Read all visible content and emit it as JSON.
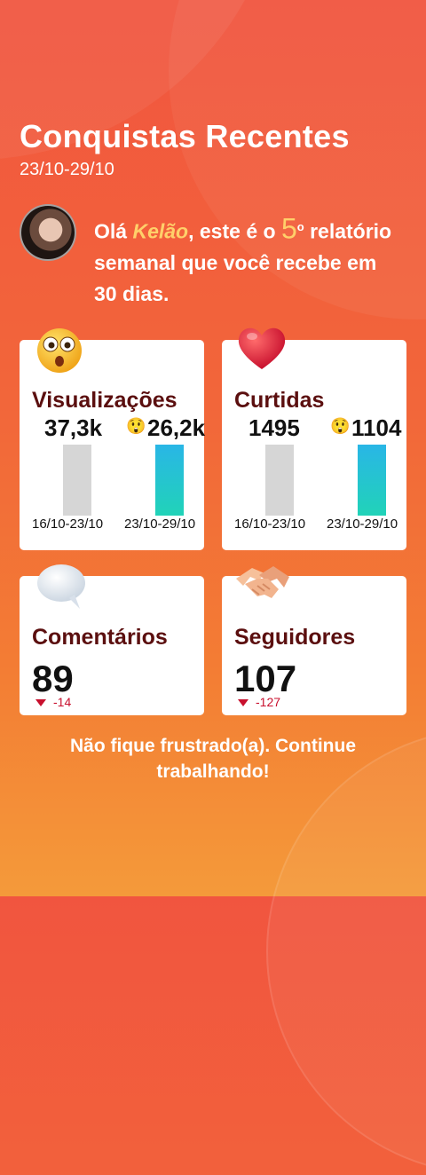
{
  "header": {
    "title": "Conquistas Recentes",
    "date_range": "23/10-29/10"
  },
  "greeting": {
    "prefix": "Olá ",
    "name": "Kelão",
    "middle": ", este é o ",
    "number": "5",
    "ordinal": "o",
    "suffix": "relatório semanal que você recebe em 30 dias."
  },
  "cards": {
    "views": {
      "label": "Visualizações",
      "previous_value": "37,3k",
      "current_value": "26,2k",
      "previous_range": "16/10-23/10",
      "current_range": "23/10-29/10",
      "icon": "surprised-face-icon"
    },
    "likes": {
      "label": "Curtidas",
      "previous_value": "1495",
      "current_value": "1104",
      "previous_range": "16/10-23/10",
      "current_range": "23/10-29/10",
      "icon": "heart-icon"
    },
    "comments": {
      "label": "Comentários",
      "value": "89",
      "delta": "-14",
      "icon": "speech-bubble-icon"
    },
    "followers": {
      "label": "Seguidores",
      "value": "107",
      "delta": "-127",
      "icon": "handshake-icon"
    }
  },
  "footer": {
    "message": "Não fique frustrado(a). Continue trabalhando!"
  },
  "colors": {
    "background_top": "#f1553f",
    "background_bottom": "#f49a3a",
    "card_label": "#5b0f0f",
    "accent_name": "#ffd06a",
    "delta_negative": "#c8102e"
  }
}
